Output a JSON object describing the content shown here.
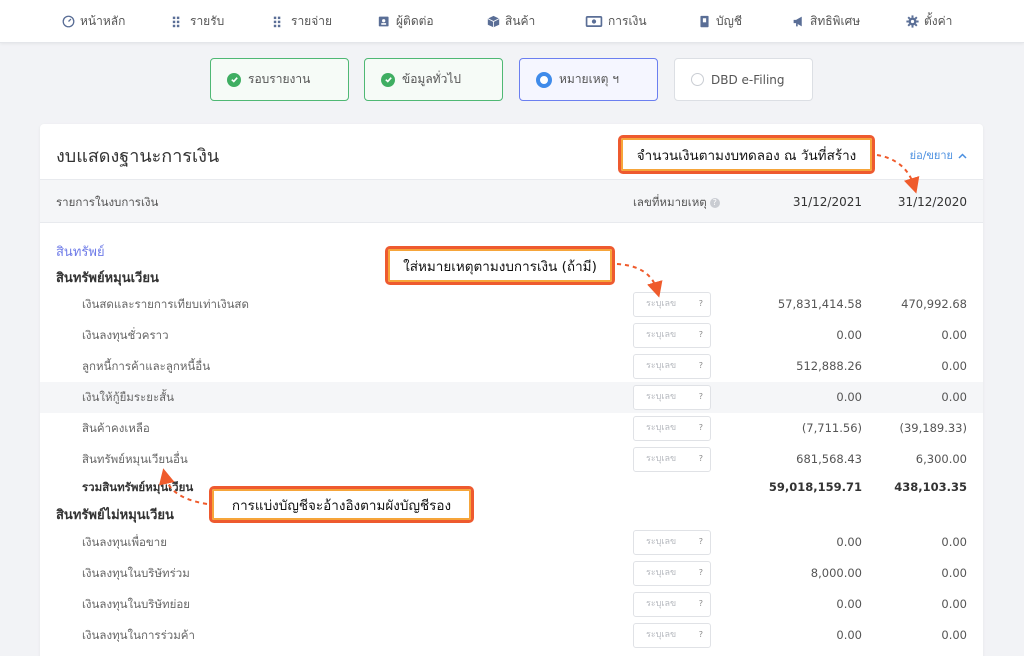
{
  "nav": [
    {
      "label": "หน้าหลัก",
      "icon": "speedometer-icon"
    },
    {
      "label": "รายรับ",
      "icon": "income-list-icon"
    },
    {
      "label": "รายจ่าย",
      "icon": "expense-list-icon"
    },
    {
      "label": "ผู้ติดต่อ",
      "icon": "contacts-icon"
    },
    {
      "label": "สินค้า",
      "icon": "box-icon"
    },
    {
      "label": "การเงิน",
      "icon": "money-icon"
    },
    {
      "label": "บัญชี",
      "icon": "ledger-icon"
    },
    {
      "label": "สิทธิพิเศษ",
      "icon": "megaphone-icon"
    },
    {
      "label": "ตั้งค่า",
      "icon": "gear-icon"
    }
  ],
  "steps": [
    {
      "label": "รอบรายงาน",
      "state": "done"
    },
    {
      "label": "ข้อมูลทั่วไป",
      "state": "done"
    },
    {
      "label": "หมายเหตุ ฯ",
      "state": "active"
    },
    {
      "label": "DBD e-Filing",
      "state": "todo"
    }
  ],
  "card": {
    "title": "งบแสดงฐานะการเงิน",
    "collapse_label": "ย่อ/ขยาย"
  },
  "table": {
    "col_item": "รายการในงบการเงิน",
    "col_note": "เลขที่หมายเหตุ",
    "col_y1": "31/12/2021",
    "col_y2": "31/12/2020",
    "note_placeholder": "ระบุเลข",
    "note_help": "?"
  },
  "sections": {
    "assets": "สินทรัพย์",
    "current": "สินทรัพย์หมุนเวียน",
    "noncurrent": "สินทรัพย์ไม่หมุนเวียน"
  },
  "current_rows": [
    {
      "label": "เงินสดและรายการเทียบเท่าเงินสด",
      "y1": "57,831,414.58",
      "y2": "470,992.68"
    },
    {
      "label": "เงินลงทุนชั่วคราว",
      "y1": "0.00",
      "y2": "0.00"
    },
    {
      "label": "ลูกหนี้การค้าและลูกหนี้อื่น",
      "y1": "512,888.26",
      "y2": "0.00"
    },
    {
      "label": "เงินให้กู้ยืมระยะสั้น",
      "y1": "0.00",
      "y2": "0.00"
    },
    {
      "label": "สินค้าคงเหลือ",
      "y1": "(7,711.56)",
      "y2": "(39,189.33)"
    },
    {
      "label": "สินทรัพย์หมุนเวียนอื่น",
      "y1": "681,568.43",
      "y2": "6,300.00"
    }
  ],
  "current_total": {
    "label": "รวมสินทรัพย์หมุนเวียน",
    "y1": "59,018,159.71",
    "y2": "438,103.35"
  },
  "noncurrent_rows": [
    {
      "label": "เงินลงทุนเพื่อขาย",
      "y1": "0.00",
      "y2": "0.00"
    },
    {
      "label": "เงินลงทุนในบริษัทร่วม",
      "y1": "8,000.00",
      "y2": "0.00"
    },
    {
      "label": "เงินลงทุนในบริษัทย่อย",
      "y1": "0.00",
      "y2": "0.00"
    },
    {
      "label": "เงินลงทุนในการร่วมค้า",
      "y1": "0.00",
      "y2": "0.00"
    }
  ],
  "callouts": {
    "balance": "จำนวนเงินตามงบทดลอง ณ วันที่สร้าง",
    "notes": "ใส่หมายเหตุตามงบการเงิน (ถ้ามี)",
    "mapping": "การแบ่งบัญชีจะอ้างอิงตามผังบัญชีรอง"
  },
  "colors": {
    "accent": "#6f7ce8",
    "done": "#3fae62",
    "callout": "#ef5b2c"
  }
}
